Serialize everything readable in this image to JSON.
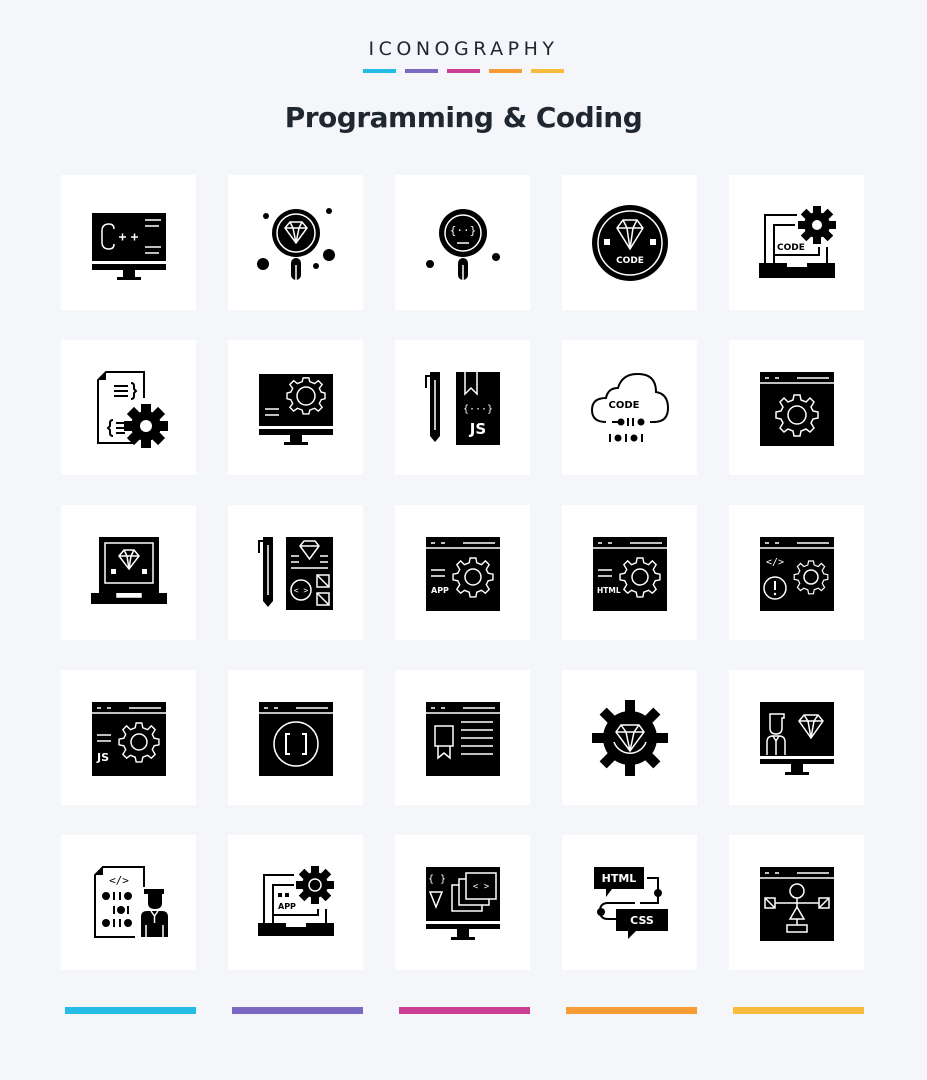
{
  "header": {
    "kicker": "ICONOGRAPHY",
    "title": "Programming & Coding"
  },
  "palette": {
    "cyan": "#25bce6",
    "purple": "#7b68c0",
    "magenta": "#cc3f95",
    "orange": "#f99b35",
    "yellow": "#f8bb3b",
    "icon": "#000000",
    "tile": "#ffffff",
    "background": "#f4f6fa"
  },
  "accent_bars": [
    "cyan",
    "purple",
    "magenta",
    "orange",
    "yellow"
  ],
  "icons": [
    {
      "name": "cpp-monitor",
      "text": "C++"
    },
    {
      "name": "diamond-search",
      "text": ""
    },
    {
      "name": "code-search",
      "text": "{··}"
    },
    {
      "name": "diamond-code-badge",
      "text": "CODE"
    },
    {
      "name": "laptop-code-settings",
      "text": "CODE"
    },
    {
      "name": "code-file-settings",
      "text": "{ }"
    },
    {
      "name": "monitor-settings",
      "text": ""
    },
    {
      "name": "js-book-pen",
      "text": "JS"
    },
    {
      "name": "cloud-code-binary",
      "text": "CODE",
      "binary": [
        "0110",
        "10101"
      ]
    },
    {
      "name": "browser-settings",
      "text": ""
    },
    {
      "name": "laptop-diamond",
      "text": ""
    },
    {
      "name": "design-document-pen",
      "text": "< >"
    },
    {
      "name": "browser-app-settings",
      "text": "APP"
    },
    {
      "name": "browser-html-settings",
      "text": "HTML"
    },
    {
      "name": "browser-code-error-settings",
      "text": "</>"
    },
    {
      "name": "browser-js-settings",
      "text": "JS"
    },
    {
      "name": "browser-brackets",
      "text": "[ ]"
    },
    {
      "name": "browser-article-badge",
      "text": ""
    },
    {
      "name": "gear-diamond",
      "text": ""
    },
    {
      "name": "monitor-developer-diamond",
      "text": ""
    },
    {
      "name": "binary-file-developer",
      "text": "</>"
    },
    {
      "name": "laptop-app-settings",
      "text": "APP"
    },
    {
      "name": "monitor-layers-code",
      "text": "< >"
    },
    {
      "name": "html-css-chat",
      "text": "HTML",
      "text2": "CSS"
    },
    {
      "name": "browser-flowchart",
      "text": ""
    }
  ]
}
